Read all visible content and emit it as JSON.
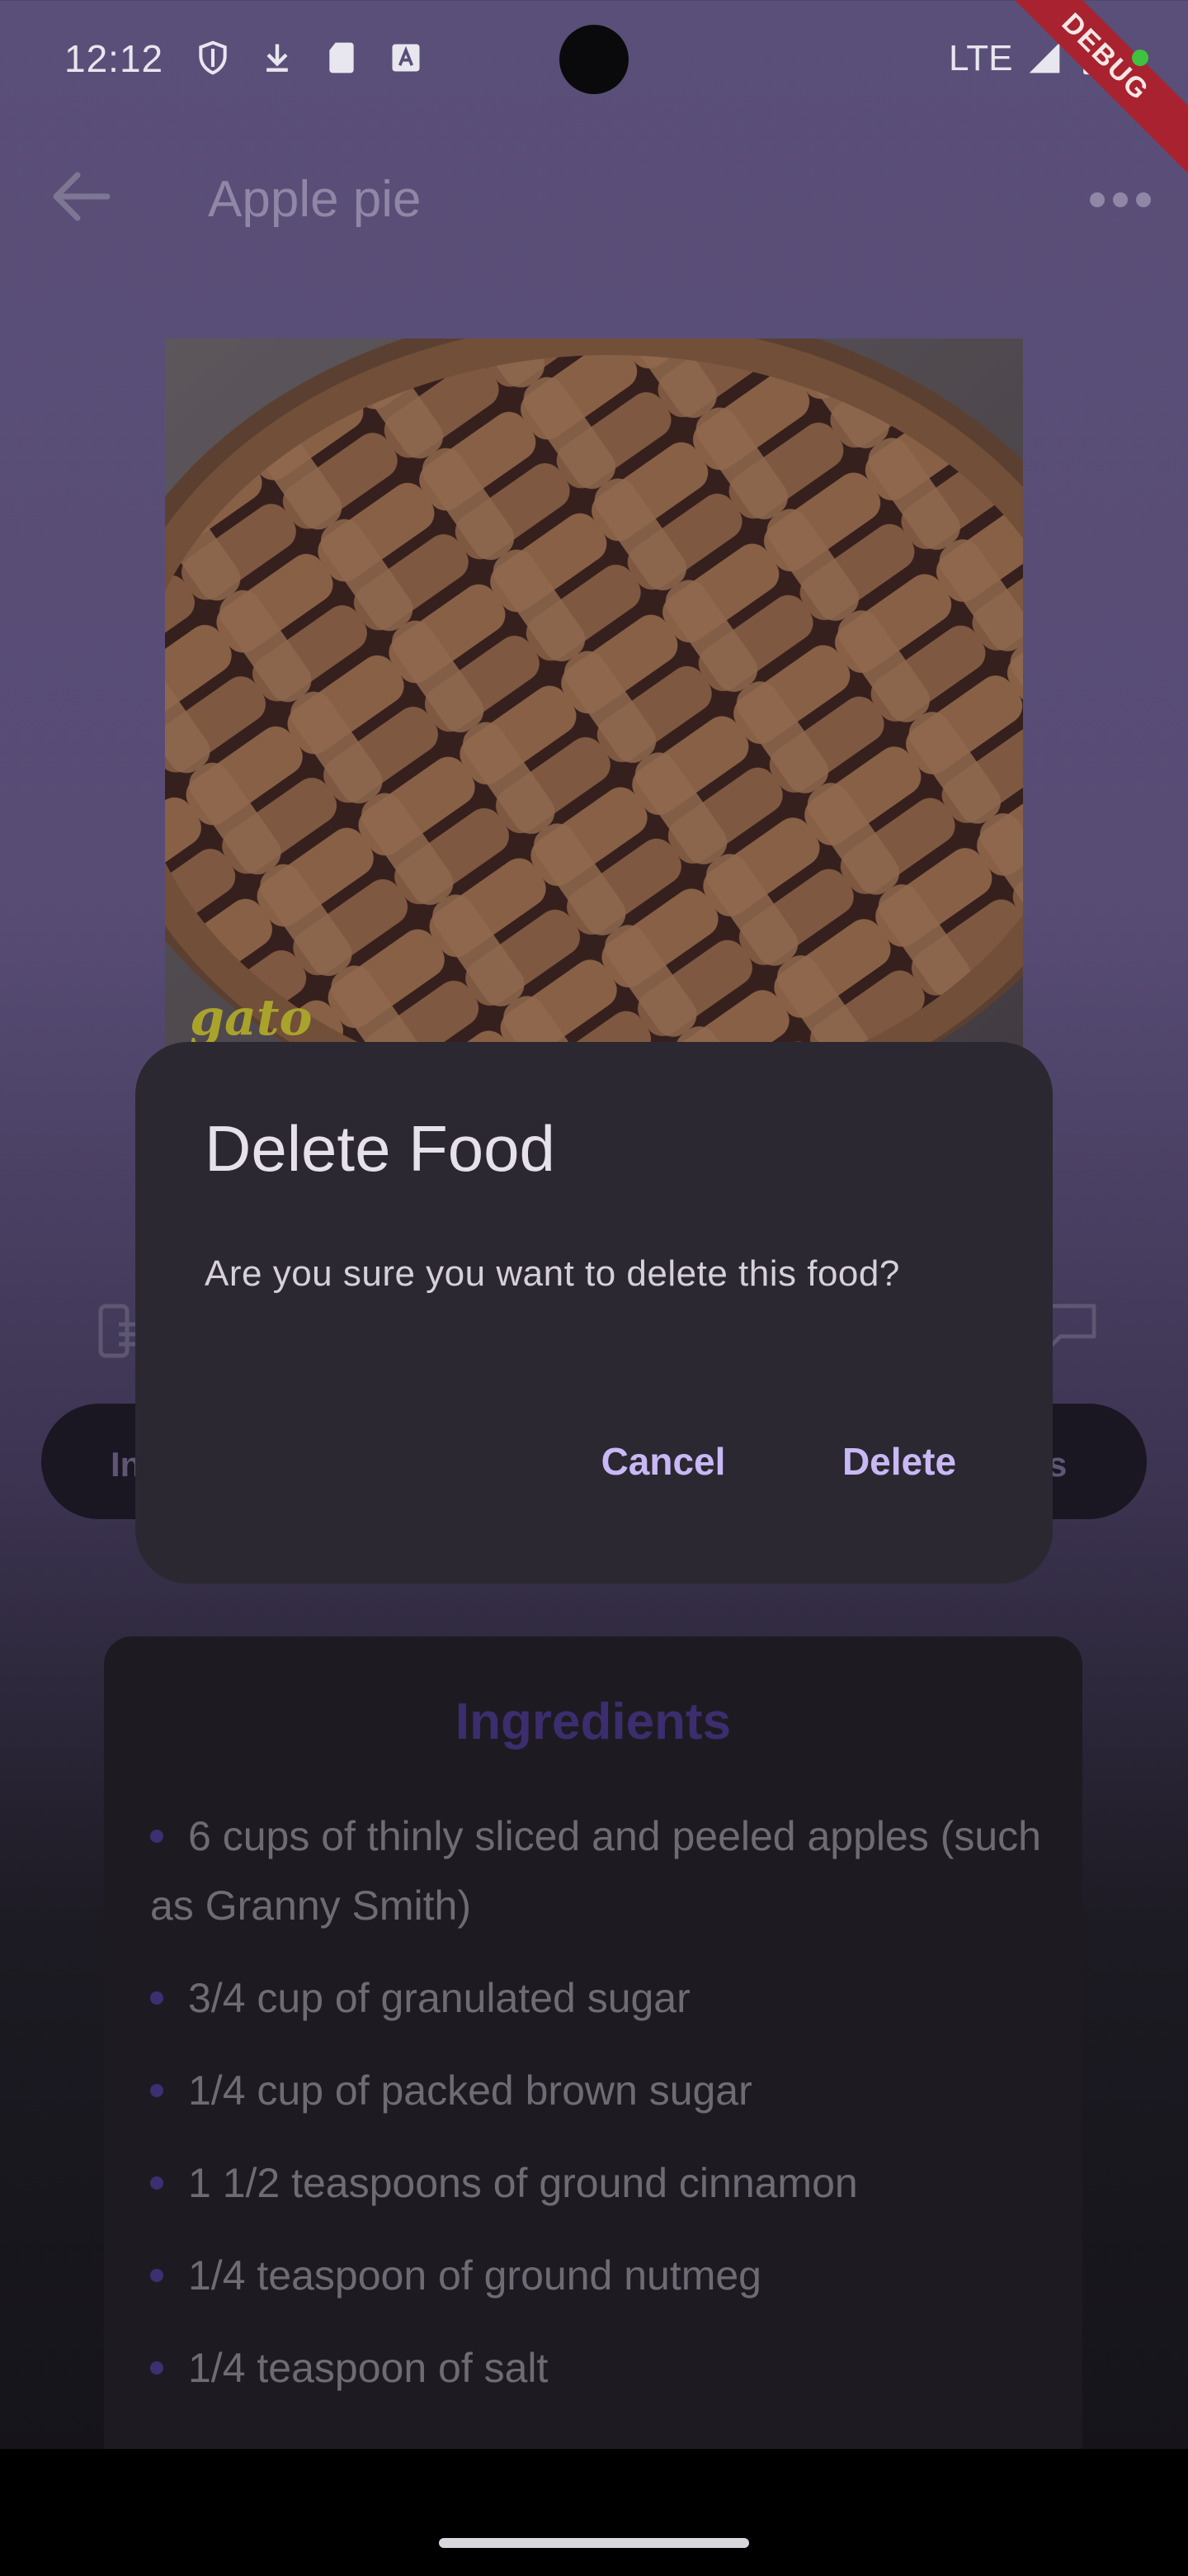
{
  "status_bar": {
    "time": "12:12",
    "network": "LTE",
    "debug_label": "DEBUG"
  },
  "app_bar": {
    "title": "Apple pie"
  },
  "hero": {
    "watermark": "gato"
  },
  "tabs": {
    "left_partial": "In",
    "right_partial": "s"
  },
  "ingredients": {
    "title": "Ingredients",
    "items": [
      "6 cups of thinly sliced and peeled apples (such as Granny Smith)",
      "3/4 cup of granulated sugar",
      "1/4 cup of packed brown sugar",
      "1 1/2 teaspoons of ground cinnamon",
      "1/4 teaspoon of ground nutmeg",
      "1/4 teaspoon of salt"
    ]
  },
  "dialog": {
    "title": "Delete Food",
    "message": "Are you sure you want to delete this food?",
    "cancel_label": "Cancel",
    "delete_label": "Delete"
  },
  "colors": {
    "accent": "#c9b8f5",
    "dialog_bg": "#2b2831",
    "scrim_top": "#5a4f78"
  }
}
